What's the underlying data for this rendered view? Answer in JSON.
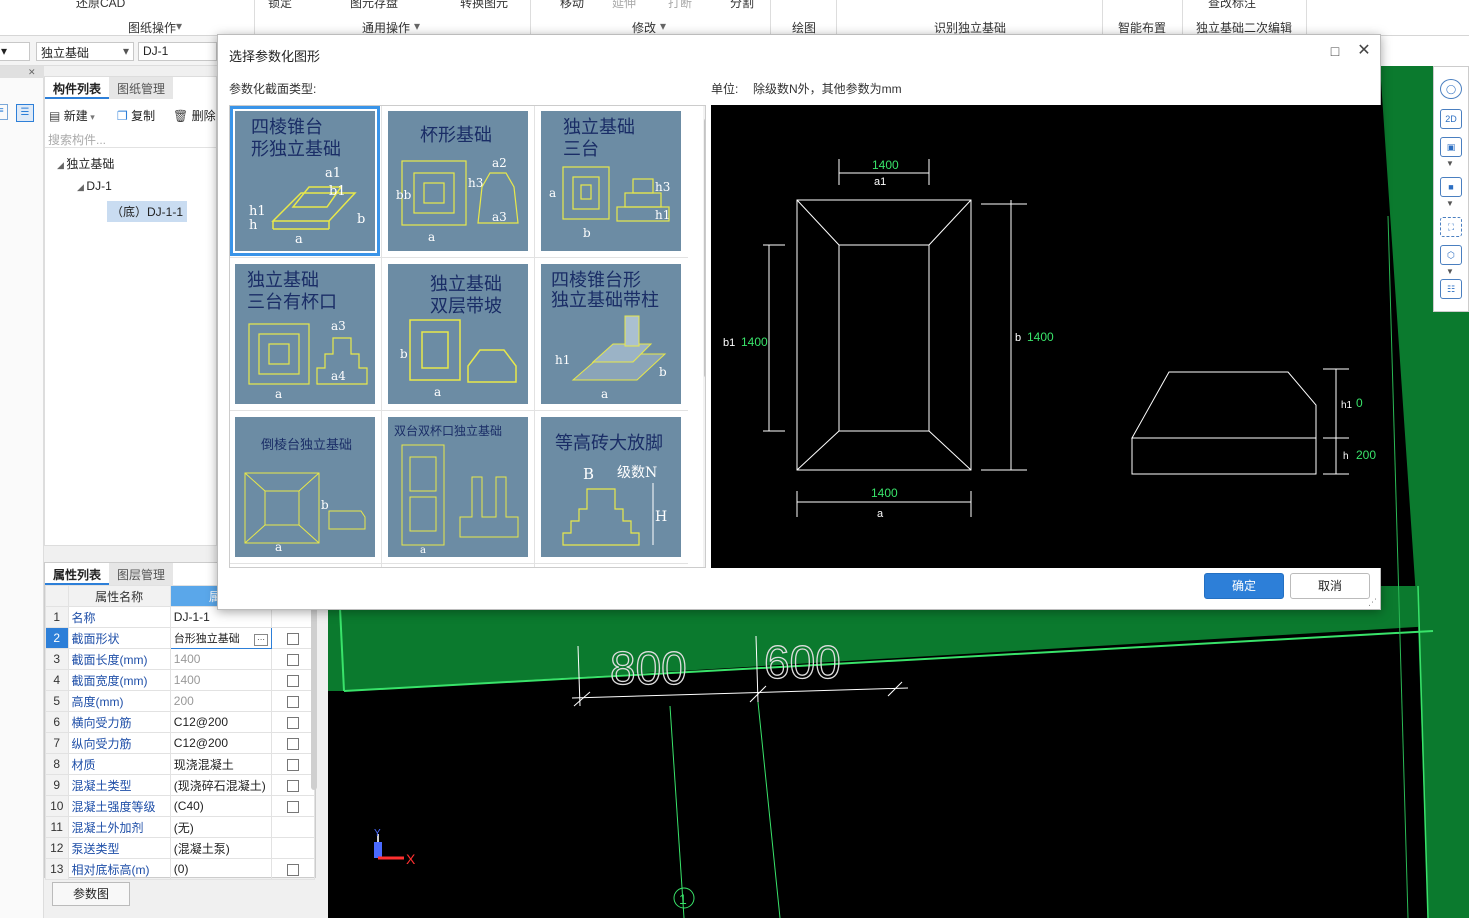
{
  "ribbon": {
    "tools": [
      "还原CAD",
      "锁定",
      "图元存盘",
      "转换图元",
      "移动",
      "延伸",
      "打断",
      "分割",
      "查改标注"
    ],
    "groups": [
      "图纸操作",
      "通用操作",
      "修改",
      "绘图",
      "识别独立基础",
      "智能布置",
      "独立基础二次编辑"
    ]
  },
  "selectors": {
    "type_value": "独立基础",
    "name_value": "DJ-1"
  },
  "component_panel": {
    "tabs": [
      "构件列表",
      "图纸管理"
    ],
    "toolbar": {
      "new": "新建",
      "copy": "复制",
      "delete": "删除"
    },
    "search_placeholder": "搜索构件...",
    "tree": {
      "root": "独立基础",
      "child": "DJ-1",
      "leaf": "（底）DJ-1-1"
    }
  },
  "property_panel": {
    "tabs": [
      "属性列表",
      "图层管理"
    ],
    "header": {
      "name_col": "属性名称",
      "value_col": "属性"
    },
    "rows": [
      {
        "index": "1",
        "name": "名称",
        "value": "DJ-1-1"
      },
      {
        "index": "2",
        "name": "截面形状",
        "value": "台形独立基础"
      },
      {
        "index": "3",
        "name": "截面长度(mm)",
        "value": "1400"
      },
      {
        "index": "4",
        "name": "截面宽度(mm)",
        "value": "1400"
      },
      {
        "index": "5",
        "name": "高度(mm)",
        "value": "200"
      },
      {
        "index": "6",
        "name": "横向受力筋",
        "value": "C12@200"
      },
      {
        "index": "7",
        "name": "纵向受力筋",
        "value": "C12@200"
      },
      {
        "index": "8",
        "name": "材质",
        "value": "现浇混凝土"
      },
      {
        "index": "9",
        "name": "混凝土类型",
        "value": "(现浇碎石混凝土)"
      },
      {
        "index": "10",
        "name": "混凝土强度等级",
        "value": "(C40)"
      },
      {
        "index": "11",
        "name": "混凝土外加剂",
        "value": "(无)"
      },
      {
        "index": "12",
        "name": "泵送类型",
        "value": "(混凝土泵)"
      },
      {
        "index": "13",
        "name": "相对底标高(m)",
        "value": "(0)"
      }
    ],
    "param_button": "参数图"
  },
  "canvas": {
    "dims": [
      "800",
      "600"
    ],
    "axis_label": "1",
    "x_axis": "X",
    "y_axis": "Y"
  },
  "right_tools": {
    "two_d": "2D"
  },
  "dialog": {
    "title": "选择参数化图形",
    "section_label": "参数化截面类型:",
    "unit_label": "单位:",
    "unit_text": "除级数N外，其他参数为mm",
    "tiles": [
      {
        "title1": "四棱锥台",
        "title2": "形独立基础"
      },
      {
        "title1": "杯形基础",
        "title2": ""
      },
      {
        "title1": "独立基础",
        "title2": "三台"
      },
      {
        "title1": "独立基础",
        "title2": "三台有杯口"
      },
      {
        "title1": "独立基础",
        "title2": "双层带坡"
      },
      {
        "title1": "四棱锥台形",
        "title2": "独立基础带柱"
      },
      {
        "title1": "倒棱台独立基础",
        "title2": ""
      },
      {
        "title1": "双台双杯口独立基础",
        "title2": ""
      },
      {
        "title1": "等高砖大放脚",
        "title2": ""
      }
    ],
    "preview": {
      "a1_value": "1400",
      "a1_label": "a1",
      "b1_label": "b1",
      "b1_value": "1400",
      "b_label": "b",
      "b_value": "1400",
      "a_value": "1400",
      "a_label": "a",
      "h1_label": "h1",
      "h1_value": "0",
      "h_label": "h",
      "h_value": "200"
    },
    "ok": "确定",
    "cancel": "取消"
  },
  "colors": {
    "accent": "#2d7fd8",
    "tile_bg": "#6c8ca4",
    "cad_green": "#39e36a",
    "tile_yellow": "#e8e84a"
  }
}
